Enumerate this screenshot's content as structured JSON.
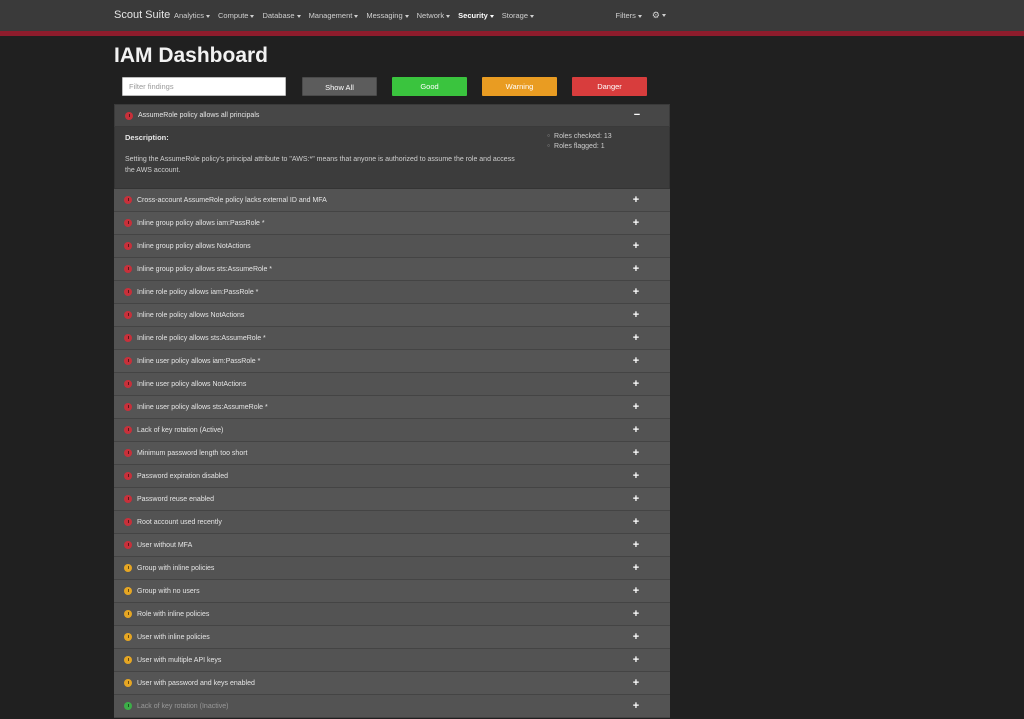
{
  "navbar": {
    "brand": "Scout Suite",
    "menu": [
      {
        "label": "Analytics"
      },
      {
        "label": "Compute"
      },
      {
        "label": "Database"
      },
      {
        "label": "Management"
      },
      {
        "label": "Messaging"
      },
      {
        "label": "Network"
      },
      {
        "label": "Security",
        "active": true
      },
      {
        "label": "Storage"
      }
    ],
    "filters_label": "Filters",
    "gear_icon": "gear-icon"
  },
  "page": {
    "title": "IAM Dashboard"
  },
  "filter_bar": {
    "placeholder": "Filter findings",
    "value": "",
    "buttons": {
      "show_all": "Show All",
      "good": "Good",
      "warning": "Warning",
      "danger": "Danger"
    }
  },
  "expanded_finding": {
    "title": "AssumeRole policy allows all principals",
    "level": "danger",
    "toggle": "−",
    "description_label": "Description:",
    "description": "Setting the AssumeRole policy's principal attribute to \"AWS:*\" means that anyone is authorized to assume the role and access the AWS account.",
    "stats": [
      "Roles checked: 13",
      "Roles flagged: 1"
    ]
  },
  "findings": [
    {
      "title": "Cross-account AssumeRole policy lacks external ID and MFA",
      "level": "danger"
    },
    {
      "title": "Inline group policy allows iam:PassRole *",
      "level": "danger"
    },
    {
      "title": "Inline group policy allows NotActions",
      "level": "danger"
    },
    {
      "title": "Inline group policy allows sts:AssumeRole *",
      "level": "danger"
    },
    {
      "title": "Inline role policy allows iam:PassRole *",
      "level": "danger"
    },
    {
      "title": "Inline role policy allows NotActions",
      "level": "danger"
    },
    {
      "title": "Inline role policy allows sts:AssumeRole *",
      "level": "danger"
    },
    {
      "title": "Inline user policy allows iam:PassRole *",
      "level": "danger"
    },
    {
      "title": "Inline user policy allows NotActions",
      "level": "danger"
    },
    {
      "title": "Inline user policy allows sts:AssumeRole *",
      "level": "danger"
    },
    {
      "title": "Lack of key rotation (Active)",
      "level": "danger"
    },
    {
      "title": "Minimum password length too short",
      "level": "danger"
    },
    {
      "title": "Password expiration disabled",
      "level": "danger"
    },
    {
      "title": "Password reuse enabled",
      "level": "danger"
    },
    {
      "title": "Root account used recently",
      "level": "danger"
    },
    {
      "title": "User without MFA",
      "level": "danger"
    },
    {
      "title": "Group with inline policies",
      "level": "warning"
    },
    {
      "title": "Group with no users",
      "level": "warning"
    },
    {
      "title": "Role with inline policies",
      "level": "warning"
    },
    {
      "title": "User with inline policies",
      "level": "warning"
    },
    {
      "title": "User with multiple API keys",
      "level": "warning"
    },
    {
      "title": "User with password and keys enabled",
      "level": "warning"
    },
    {
      "title": "Lack of key rotation (Inactive)",
      "level": "good"
    }
  ],
  "row_toggle": "+",
  "colors": {
    "danger": "#c8303a",
    "warning": "#e6a623",
    "good": "#3cae48",
    "nav_stripe": "#8e1c2c"
  }
}
